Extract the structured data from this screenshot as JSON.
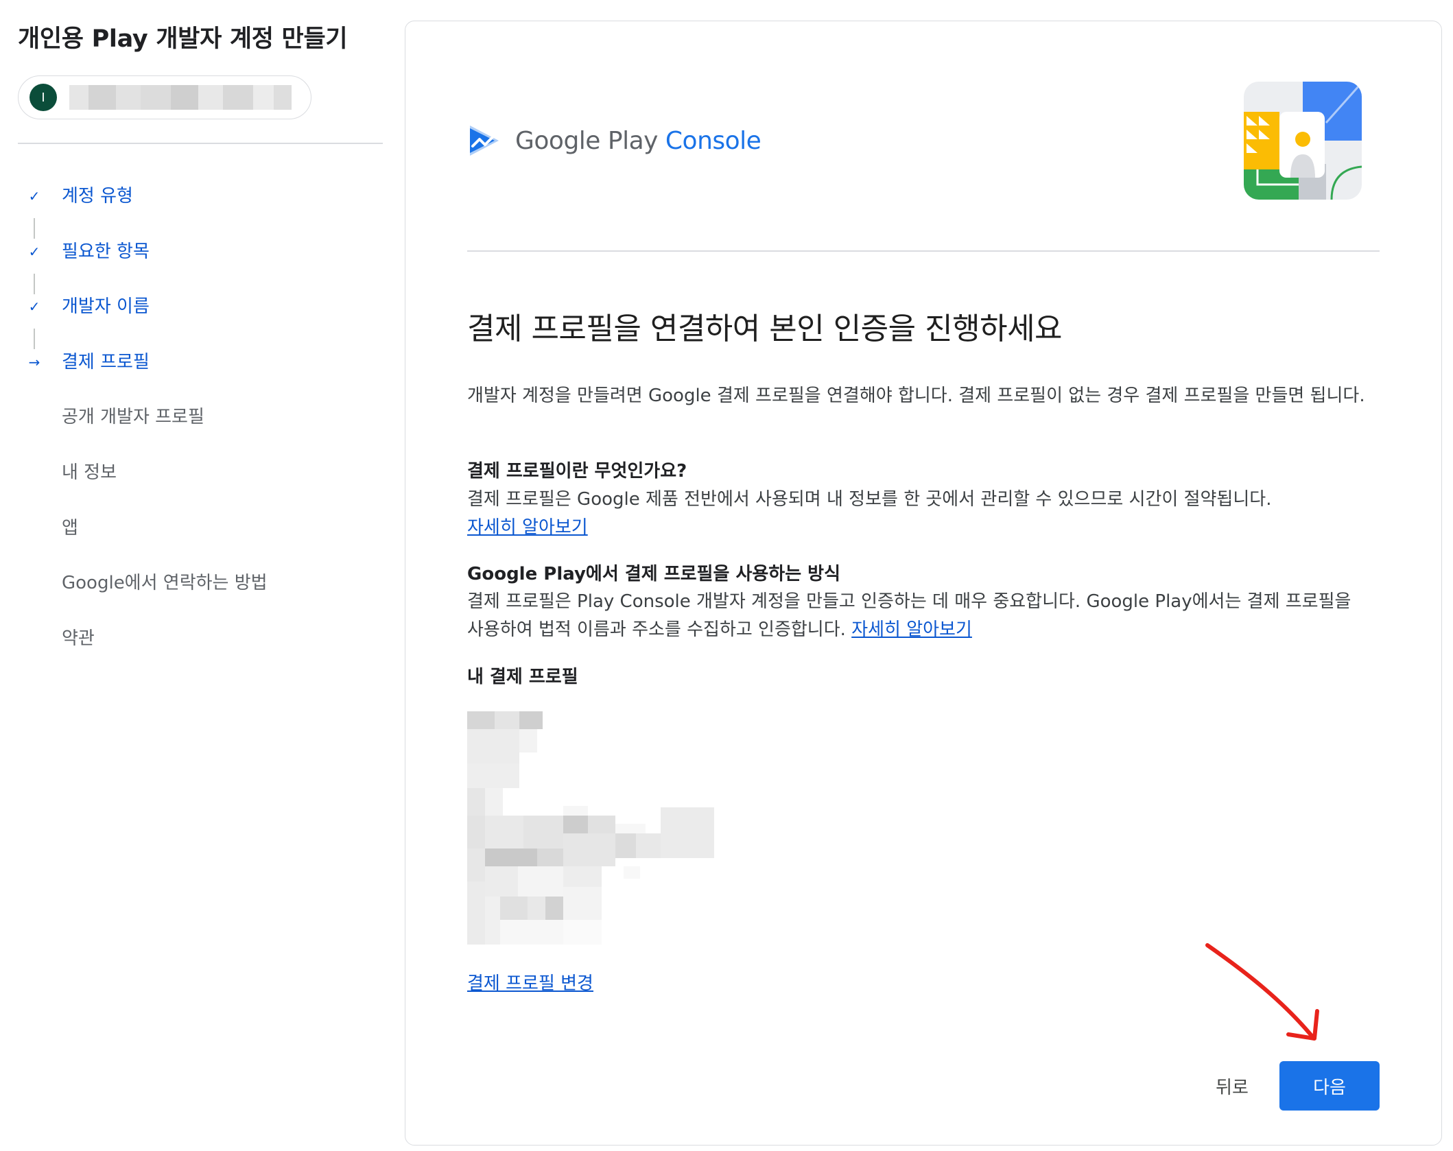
{
  "sidebar": {
    "title": "개인용 Play 개발자 계정 만들기",
    "account": {
      "avatar_initial": "I"
    },
    "steps": [
      {
        "label": "계정 유형",
        "state": "done"
      },
      {
        "label": "필요한 항목",
        "state": "done"
      },
      {
        "label": "개발자 이름",
        "state": "done"
      },
      {
        "label": "결제 프로필",
        "state": "current"
      },
      {
        "label": "공개 개발자 프로필",
        "state": "pending"
      },
      {
        "label": "내 정보",
        "state": "pending"
      },
      {
        "label": "앱",
        "state": "pending"
      },
      {
        "label": "Google에서 연락하는 방법",
        "state": "pending"
      },
      {
        "label": "약관",
        "state": "pending"
      }
    ]
  },
  "main": {
    "logo": {
      "prefix": "Google Play",
      "accent": "Console"
    },
    "heading": "결제 프로필을 연결하여 본인 인증을 진행하세요",
    "intro": "개발자 계정을 만들려면 Google 결제 프로필을 연결해야 합니다. 결제 프로필이 없는 경우 결제 프로필을 만들면 됩니다.",
    "what_is": {
      "title": "결제 프로필이란 무엇인가요?",
      "body": "결제 프로필은 Google 제품 전반에서 사용되며 내 정보를 한 곳에서 관리할 수 있으므로 시간이 절약됩니다.",
      "link": "자세히 알아보기"
    },
    "how_used": {
      "title": "Google Play에서 결제 프로필을 사용하는 방식",
      "body": "결제 프로필은 Play Console 개발자 계정을 만들고 인증하는 데 매우 중요합니다. Google Play에서는 결제 프로필을 사용하여 법적 이름과 주소를 수집하고 인증합니다.",
      "link": "자세히 알아보기"
    },
    "my_profile_title": "내 결제 프로필",
    "change_profile": "결제 프로필 변경",
    "back_label": "뒤로",
    "next_label": "다음"
  },
  "colors": {
    "accent": "#1a73e8",
    "link": "#0b57d0",
    "avatar": "#0b4d3a",
    "annotation_arrow": "#e8231b"
  }
}
